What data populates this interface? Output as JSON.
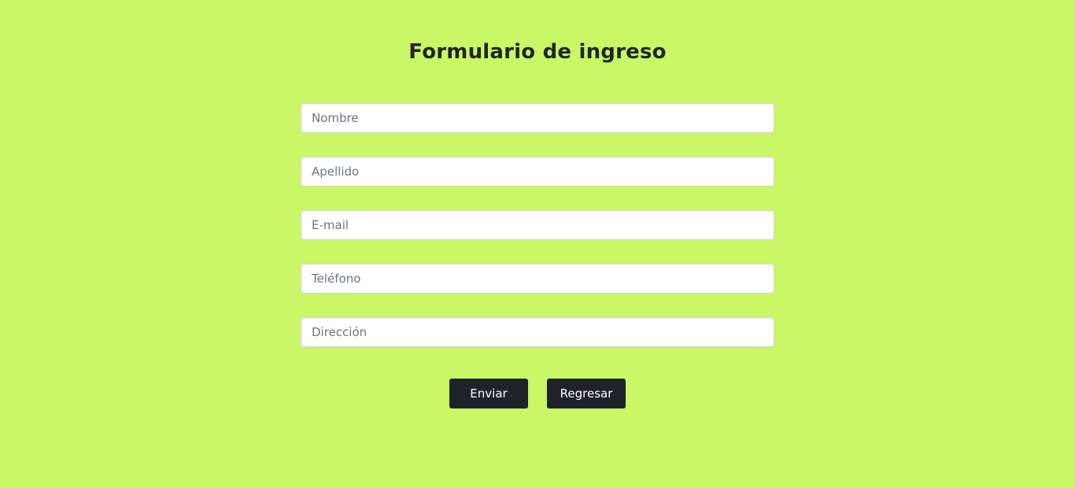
{
  "form": {
    "title": "Formulario de ingreso",
    "fields": [
      {
        "name": "nombre",
        "placeholder": "Nombre",
        "value": ""
      },
      {
        "name": "apellido",
        "placeholder": "Apellido",
        "value": ""
      },
      {
        "name": "email",
        "placeholder": "E-mail",
        "value": ""
      },
      {
        "name": "telefono",
        "placeholder": "Teléfono",
        "value": ""
      },
      {
        "name": "direccion",
        "placeholder": "Dirección",
        "value": ""
      }
    ],
    "buttons": {
      "submit_label": "Enviar",
      "back_label": "Regresar"
    }
  },
  "colors": {
    "background": "#c9f766",
    "button_background": "#1f2228",
    "button_text": "#ffffff",
    "title_text": "#212529"
  }
}
